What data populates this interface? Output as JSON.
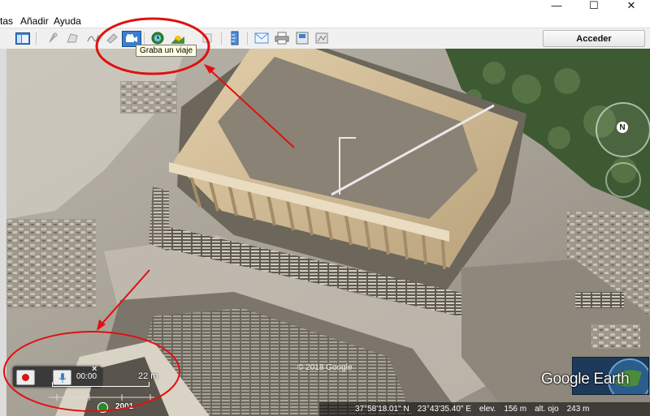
{
  "menu": {
    "items": [
      {
        "label": "tas"
      },
      {
        "label": "Añadir"
      },
      {
        "label": "Ayuda"
      }
    ]
  },
  "window_controls": {
    "minimize": "—",
    "maximize": "☐",
    "close": "✕"
  },
  "toolbar": {
    "acceder_label": "Acceder",
    "tooltip": "Graba un viaje",
    "icons": [
      "sidebar-icon",
      "placemark-icon",
      "polygon-icon",
      "path-icon",
      "image-overlay-icon",
      "record-tour-icon",
      "historical-imagery-icon",
      "sunlight-icon",
      "planets-icon",
      "ruler-icon",
      "email-icon",
      "print-icon",
      "save-image-icon",
      "maps-icon"
    ]
  },
  "map": {
    "copyright": "© 2018 Google",
    "logo": "Google Earth",
    "scale_label": "22 m",
    "year": "2001",
    "status": {
      "lat": "37°58'18.01\" N",
      "lon": "23°43'35.40\" E",
      "elev_label": "elev.",
      "elev_value": "156 m",
      "alt_label": "alt. ojo",
      "alt_value": "243 m"
    },
    "compass_letter": "N"
  },
  "recorder": {
    "time": "00:00",
    "close": "×"
  },
  "colors": {
    "annotation_red": "#e01010",
    "record_red": "#d01818",
    "toolbar_bg": "#f0f0f0"
  }
}
